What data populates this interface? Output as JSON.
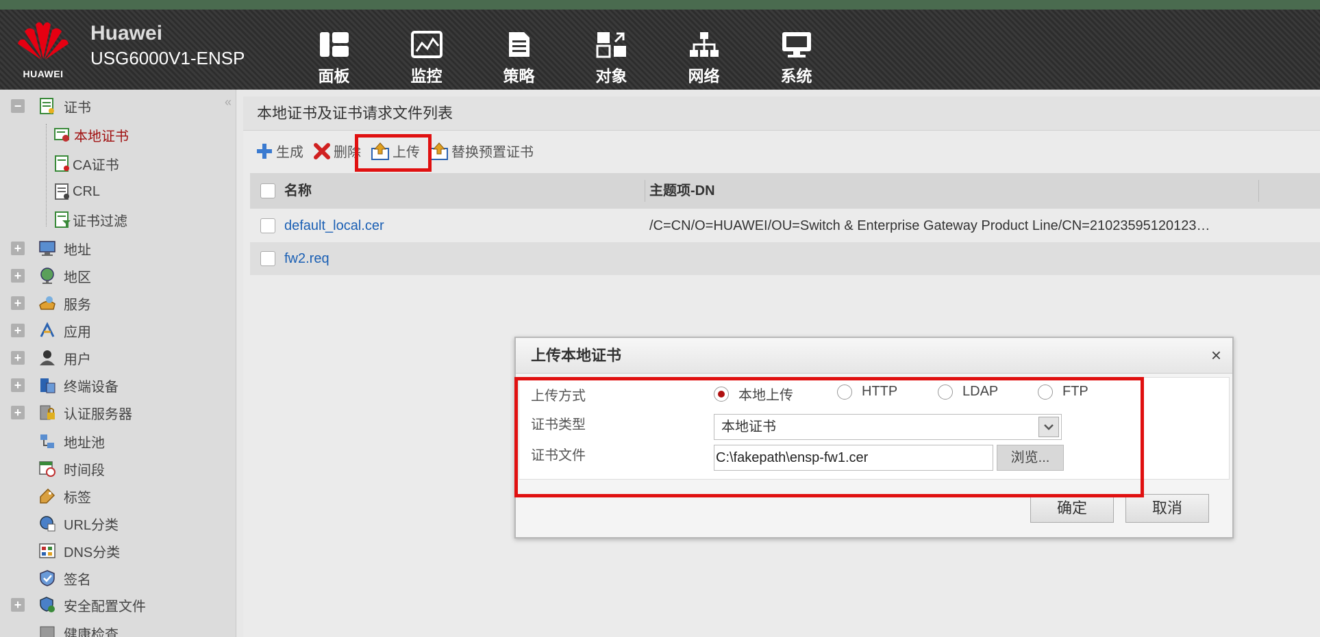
{
  "header": {
    "logo_text": "HUAWEI",
    "brand_name": "Huawei",
    "model": "USG6000V1-ENSP",
    "nav": [
      {
        "label": "面板",
        "icon": "dashboard-icon"
      },
      {
        "label": "监控",
        "icon": "monitor-icon"
      },
      {
        "label": "策略",
        "icon": "policy-icon"
      },
      {
        "label": "对象",
        "icon": "object-icon"
      },
      {
        "label": "网络",
        "icon": "network-icon"
      },
      {
        "label": "系统",
        "icon": "system-icon"
      }
    ]
  },
  "sidebar": {
    "collapse_glyph": "«",
    "items": [
      {
        "label": "证书",
        "expander": "−"
      },
      {
        "label": "本地证书"
      },
      {
        "label": "CA证书"
      },
      {
        "label": "CRL"
      },
      {
        "label": "证书过滤"
      },
      {
        "label": "地址",
        "expander": "+"
      },
      {
        "label": "地区",
        "expander": "+"
      },
      {
        "label": "服务",
        "expander": "+"
      },
      {
        "label": "应用",
        "expander": "+"
      },
      {
        "label": "用户",
        "expander": "+"
      },
      {
        "label": "终端设备",
        "expander": "+"
      },
      {
        "label": "认证服务器",
        "expander": "+"
      },
      {
        "label": "地址池"
      },
      {
        "label": "时间段"
      },
      {
        "label": "标签"
      },
      {
        "label": "URL分类"
      },
      {
        "label": "DNS分类"
      },
      {
        "label": "签名"
      },
      {
        "label": "安全配置文件",
        "expander": "+"
      },
      {
        "label": "健康检查"
      }
    ]
  },
  "main": {
    "title": "本地证书及证书请求文件列表",
    "toolbar": {
      "generate": "生成",
      "delete": "删除",
      "upload": "上传",
      "replace": "替换预置证书"
    },
    "table": {
      "columns": [
        "名称",
        "主题项-DN"
      ],
      "rows": [
        {
          "name": "default_local.cer",
          "dn": "/C=CN/O=HUAWEI/OU=Switch & Enterprise Gateway Product Line/CN=21023595120123…"
        },
        {
          "name": "fw2.req",
          "dn": ""
        }
      ]
    }
  },
  "dialog": {
    "title": "上传本地证书",
    "close": "×",
    "upload_method_label": "上传方式",
    "upload_methods": [
      "本地上传",
      "HTTP",
      "LDAP",
      "FTP"
    ],
    "selected_method": "本地上传",
    "cert_type_label": "证书类型",
    "cert_type_value": "本地证书",
    "cert_file_label": "证书文件",
    "cert_file_value": "C:\\fakepath\\ensp-fw1.cer",
    "browse": "浏览...",
    "ok": "确定",
    "cancel": "取消"
  },
  "colors": {
    "highlight": "#e01010",
    "link": "#1a5fb4",
    "header_bg": "#333333"
  }
}
